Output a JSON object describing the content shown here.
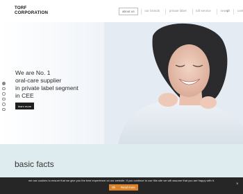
{
  "header": {
    "logo_line1": "TORF",
    "logo_line2": "CORPORATION",
    "nav": [
      {
        "label": "about us",
        "active": true
      },
      {
        "label": "our brands",
        "active": false
      },
      {
        "label": "private label",
        "active": false
      },
      {
        "label": "toll service",
        "active": false
      },
      {
        "label": "news",
        "active": false
      },
      {
        "label": "contact",
        "active": false
      }
    ],
    "language": "pl"
  },
  "hero": {
    "line1": "We are No. 1",
    "line2": "oral-care supplier",
    "line3": "in private label segment",
    "line4": "in CEE",
    "button": "learn more",
    "dots_count": 6,
    "active_dot": 1
  },
  "facts": {
    "title": "basic facts"
  },
  "cookie": {
    "text": "we use cookies to ensure that we give you the best experience on our website. If you continue to use this site we will assume that you are happy with it.",
    "ok": "Ok",
    "more": "Read more",
    "close": "×"
  },
  "colors": {
    "cookie_button": "#d9822b",
    "facts_band": "#dfecef",
    "hero_button": "#1e1e1e"
  }
}
